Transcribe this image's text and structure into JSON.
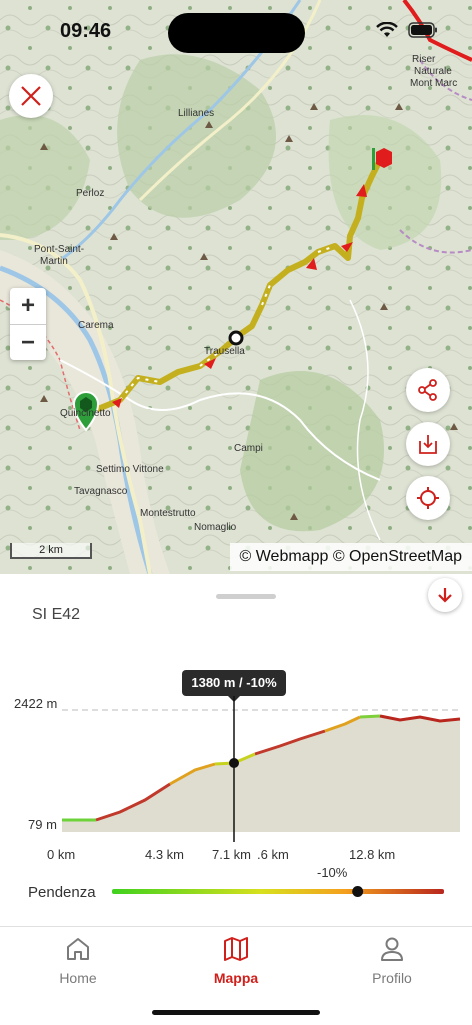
{
  "status_bar": {
    "time": "09:46"
  },
  "map": {
    "attribution": "© Webmapp © OpenStreetMap",
    "scale_label": "2 km",
    "zoom_in_label": "+",
    "zoom_out_label": "−",
    "places": [
      "Lillianes",
      "Perloz",
      "Pont-Saint-",
      "Martin",
      "Carema",
      "Quincinetto",
      "Trausella",
      "Campi",
      "Settimo Vittone",
      "Tavagnasco",
      "Montestrutto",
      "Nomaglio",
      "Riser",
      "Naturale",
      "Mont Marc"
    ]
  },
  "route": {
    "title": "SI E42"
  },
  "elevation": {
    "tooltip": "1380 m / -10%",
    "max_label": "2422 m",
    "min_label": "79 m",
    "x_labels": [
      "0 km",
      "4.3 km",
      "7.1 km",
      ".6 km",
      "12.8 km"
    ],
    "slope_label": "Pendenza",
    "slope_value": "-10%",
    "slope_position": 0.74
  },
  "tabs": [
    {
      "label": "Home",
      "icon": "home-icon"
    },
    {
      "label": "Mappa",
      "icon": "map-icon"
    },
    {
      "label": "Profilo",
      "icon": "profile-icon"
    }
  ],
  "colors": {
    "accent": "#d0201c",
    "track": "#c4b01e",
    "start_marker": "#2e9e3a",
    "end_marker": "#e01c1c"
  }
}
